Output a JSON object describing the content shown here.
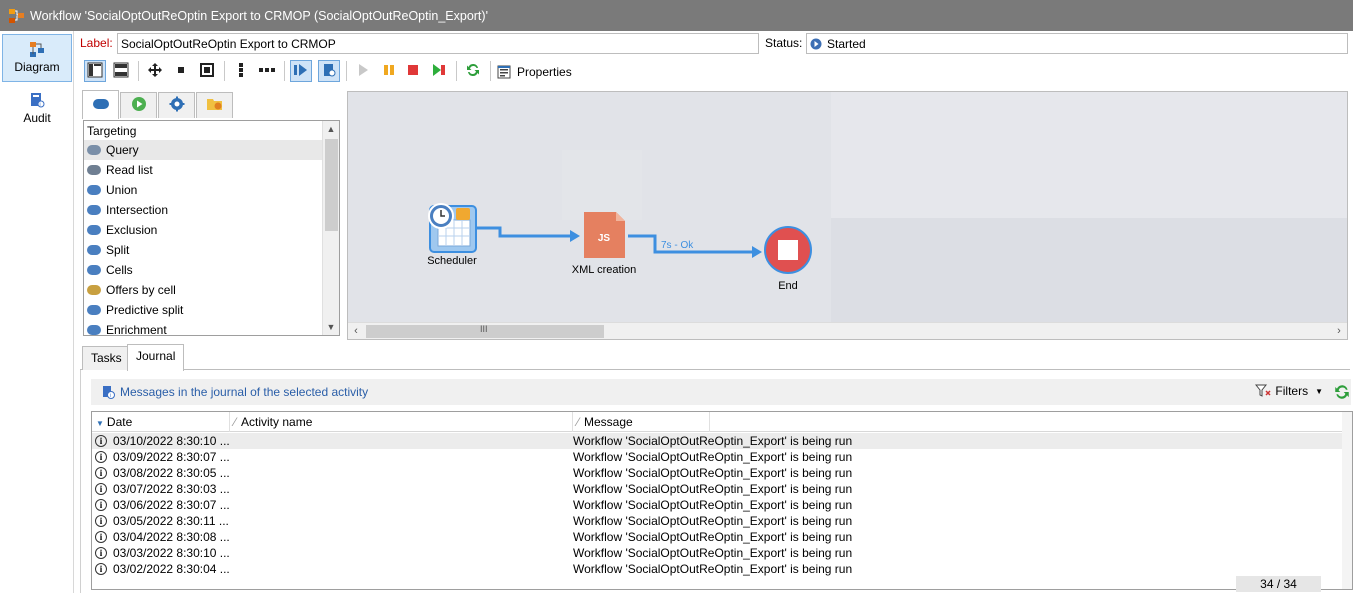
{
  "window": {
    "title": "Workflow 'SocialOptOutReOptin Export to CRMOP (SocialOptOutReOptin_Export)'"
  },
  "nav": {
    "diagram": "Diagram",
    "audit": "Audit"
  },
  "form": {
    "label_caption": "Label:",
    "label_value": "SocialOptOutReOptin Export to CRMOP",
    "status_caption": "Status:",
    "status_value": "Started"
  },
  "toolbar": {
    "properties_label": "Properties"
  },
  "palette": {
    "category": "Targeting",
    "items": [
      {
        "label": "Query",
        "icon": "query-icon"
      },
      {
        "label": "Read list",
        "icon": "read-list-icon"
      },
      {
        "label": "Union",
        "icon": "union-icon"
      },
      {
        "label": "Intersection",
        "icon": "intersection-icon"
      },
      {
        "label": "Exclusion",
        "icon": "exclusion-icon"
      },
      {
        "label": "Split",
        "icon": "split-icon"
      },
      {
        "label": "Cells",
        "icon": "cells-icon"
      },
      {
        "label": "Offers by cell",
        "icon": "offers-icon"
      },
      {
        "label": "Predictive split",
        "icon": "predictive-icon"
      },
      {
        "label": "Enrichment",
        "icon": "enrichment-icon"
      }
    ]
  },
  "diagram": {
    "nodes": {
      "scheduler": "Scheduler",
      "xml": "XML creation",
      "end": "End"
    },
    "transition_label": "7s - Ok",
    "js_badge": "JS",
    "hscroll_grip": "III"
  },
  "bottom_tabs": {
    "tasks": "Tasks",
    "journal": "Journal"
  },
  "journal": {
    "title": "Messages in the journal of the selected activity",
    "filters_label": "Filters",
    "columns": {
      "date": "Date",
      "activity": "Activity name",
      "message": "Message"
    },
    "rows": [
      {
        "date": "03/10/2022 8:30:10 ...",
        "activity": "",
        "message": "Workflow 'SocialOptOutReOptin_Export' is being run"
      },
      {
        "date": "03/09/2022 8:30:07 ...",
        "activity": "",
        "message": "Workflow 'SocialOptOutReOptin_Export' is being run"
      },
      {
        "date": "03/08/2022 8:30:05 ...",
        "activity": "",
        "message": "Workflow 'SocialOptOutReOptin_Export' is being run"
      },
      {
        "date": "03/07/2022 8:30:03 ...",
        "activity": "",
        "message": "Workflow 'SocialOptOutReOptin_Export' is being run"
      },
      {
        "date": "03/06/2022 8:30:07 ...",
        "activity": "",
        "message": "Workflow 'SocialOptOutReOptin_Export' is being run"
      },
      {
        "date": "03/05/2022 8:30:11 ...",
        "activity": "",
        "message": "Workflow 'SocialOptOutReOptin_Export' is being run"
      },
      {
        "date": "03/04/2022 8:30:08 ...",
        "activity": "",
        "message": "Workflow 'SocialOptOutReOptin_Export' is being run"
      },
      {
        "date": "03/03/2022 8:30:10 ...",
        "activity": "",
        "message": "Workflow 'SocialOptOutReOptin_Export' is being run"
      },
      {
        "date": "03/02/2022 8:30:04 ...",
        "activity": "",
        "message": "Workflow 'SocialOptOutReOptin_Export' is being run"
      }
    ],
    "pager": "34 / 34"
  },
  "colors": {
    "titlebar": "#7a7a7a",
    "accent_blue": "#3d8fe0",
    "end_red": "#e05050",
    "js_orange": "#e58060"
  }
}
